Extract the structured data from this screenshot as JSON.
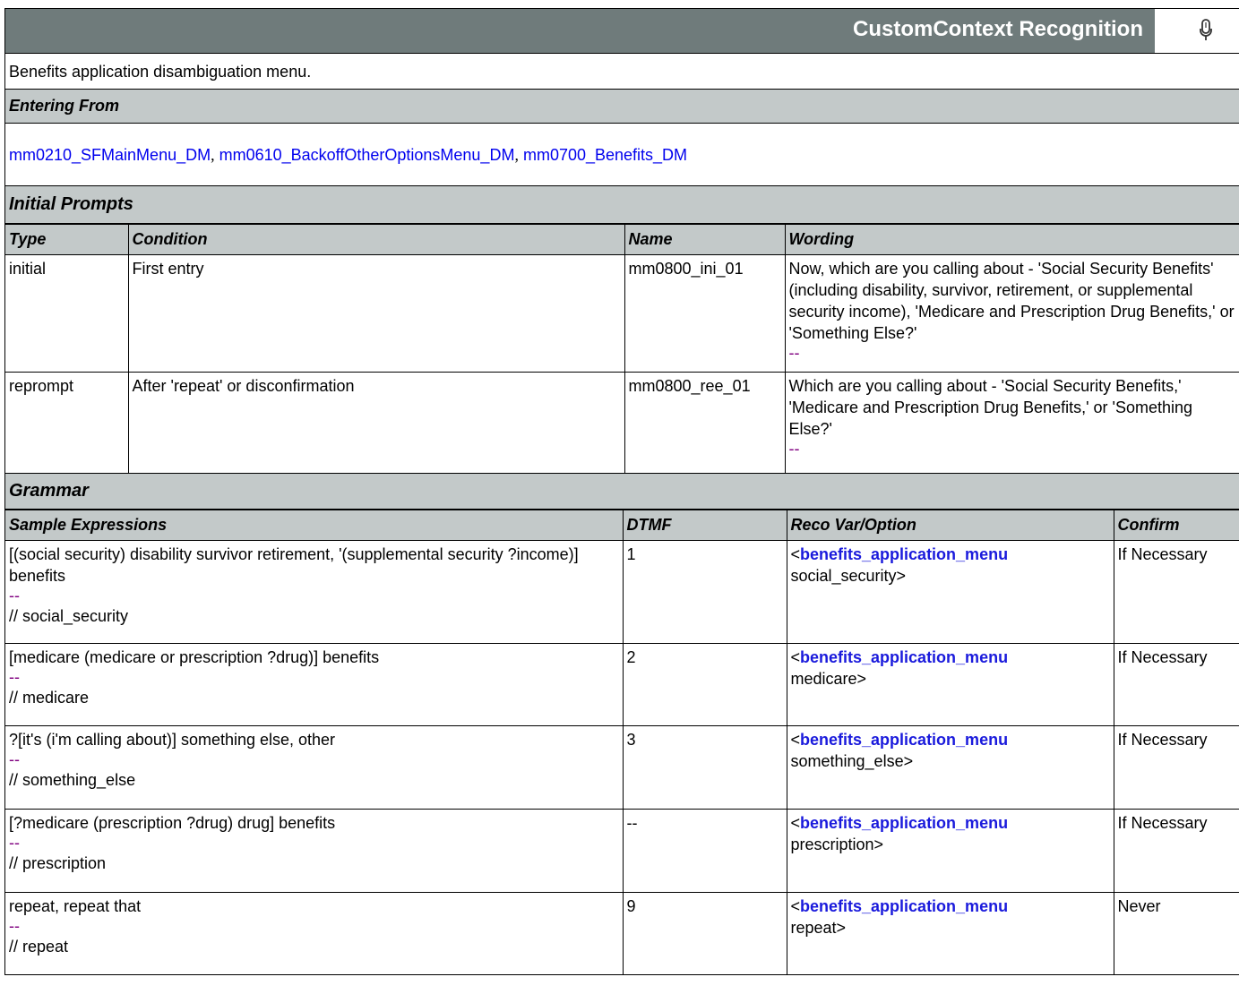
{
  "header": {
    "title": "CustomContext Recognition",
    "mic_icon": "microphone-icon"
  },
  "description": "Benefits application disambiguation menu.",
  "entering_from": {
    "label": "Entering From",
    "links": [
      "mm0210_SFMainMenu_DM",
      "mm0610_BackoffOtherOptionsMenu_DM",
      "mm0700_Benefits_DM"
    ],
    "separator": ","
  },
  "initial_prompts": {
    "label": "Initial Prompts",
    "columns": [
      "Type",
      "Condition",
      "Name",
      "Wording"
    ],
    "rows": [
      {
        "type": "initial",
        "condition": "First entry",
        "name": "mm0800_ini_01",
        "wording": "Now, which are you calling about - 'Social Security Benefits' (including disability, survivor, retirement, or supplemental security income), 'Medicare and Prescription Drug Benefits,' or 'Something Else?'",
        "dashes": "--"
      },
      {
        "type": "reprompt",
        "condition": "After 'repeat' or disconfirmation",
        "name": "mm0800_ree_01",
        "wording": "Which are you calling about - 'Social Security Benefits,' 'Medicare and Prescription Drug Benefits,' or 'Something Else?'",
        "dashes": "--"
      }
    ]
  },
  "grammar": {
    "label": "Grammar",
    "columns": [
      "Sample Expressions",
      "DTMF",
      "Reco Var/Option",
      "Confirm"
    ],
    "rows": [
      {
        "expression": "[(social security) disability survivor retirement, '(supplemental security ?income)] benefits",
        "dashes": "--",
        "comment": "// social_security",
        "dtmf": "1",
        "var_prefix": "<",
        "var_name": "benefits_application_menu",
        "var_value": "social_security>",
        "confirm": "If Necessary"
      },
      {
        "expression": "[medicare (medicare or prescription ?drug)] benefits",
        "dashes": "--",
        "comment": "// medicare",
        "dtmf": "2",
        "var_prefix": "<",
        "var_name": "benefits_application_menu",
        "var_value": "medicare>",
        "confirm": "If Necessary"
      },
      {
        "expression": "?[it's (i'm calling about)] something else, other",
        "dashes": "--",
        "comment": "// something_else",
        "dtmf": "3",
        "var_prefix": "<",
        "var_name": "benefits_application_menu",
        "var_value": "something_else>",
        "confirm": "If Necessary"
      },
      {
        "expression": "[?medicare (prescription ?drug) drug] benefits",
        "dashes": "--",
        "comment": "// prescription",
        "dtmf": "--",
        "var_prefix": "<",
        "var_name": "benefits_application_menu",
        "var_value": "prescription>",
        "confirm": "If Necessary"
      },
      {
        "expression": "repeat, repeat that",
        "dashes": "--",
        "comment": "// repeat",
        "dtmf": "9",
        "var_prefix": "<",
        "var_name": "benefits_application_menu",
        "var_value": "repeat>",
        "confirm": "Never"
      }
    ]
  }
}
